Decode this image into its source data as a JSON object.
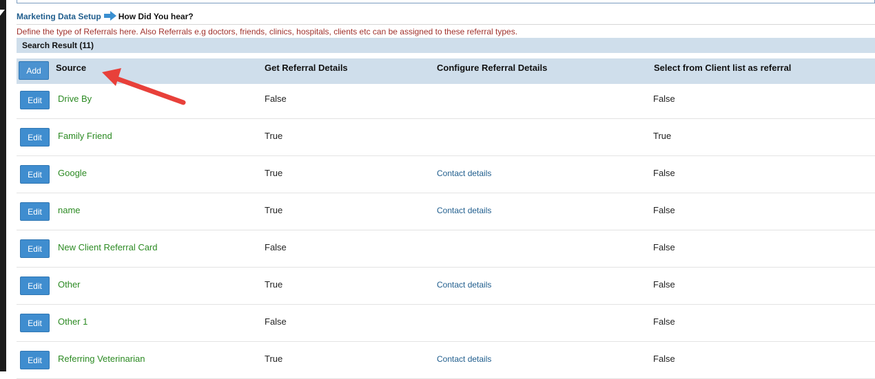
{
  "breadcrumb": {
    "parent": "Marketing Data Setup",
    "current": "How Did You hear?"
  },
  "description": "Define the type of Referrals here. Also Referrals e.g doctors, friends, clinics, hospitals, clients etc can be assigned to these referral types.",
  "search_result": "Search Result (11)",
  "table": {
    "add_label": "Add",
    "edit_label": "Edit",
    "columns": [
      "Source",
      "Get Referral Details",
      "Configure Referral Details",
      "Select from Client list as referral"
    ],
    "rows": [
      {
        "source": "Drive By",
        "get": "False",
        "configure": "",
        "select": "False"
      },
      {
        "source": "Family Friend",
        "get": "True",
        "configure": "",
        "select": "True"
      },
      {
        "source": "Google",
        "get": "True",
        "configure": "Contact details",
        "select": "False"
      },
      {
        "source": "name",
        "get": "True",
        "configure": "Contact details",
        "select": "False"
      },
      {
        "source": "New Client Referral Card",
        "get": "False",
        "configure": "",
        "select": "False"
      },
      {
        "source": "Other",
        "get": "True",
        "configure": "Contact details",
        "select": "False"
      },
      {
        "source": "Other 1",
        "get": "False",
        "configure": "",
        "select": "False"
      },
      {
        "source": "Referring Veterinarian",
        "get": "True",
        "configure": "Contact details",
        "select": "False"
      }
    ]
  },
  "colors": {
    "header_bg": "#cfdeeb",
    "button_blue": "#3f8dcf",
    "source_green": "#2b8a22",
    "description_red": "#a0322d",
    "link_blue": "#1f5d8d",
    "annotation_arrow": "#e8403a"
  },
  "icons": {
    "breadcrumb_separator": "arrow-right-icon",
    "annotation": "red-arrow-annotation"
  }
}
